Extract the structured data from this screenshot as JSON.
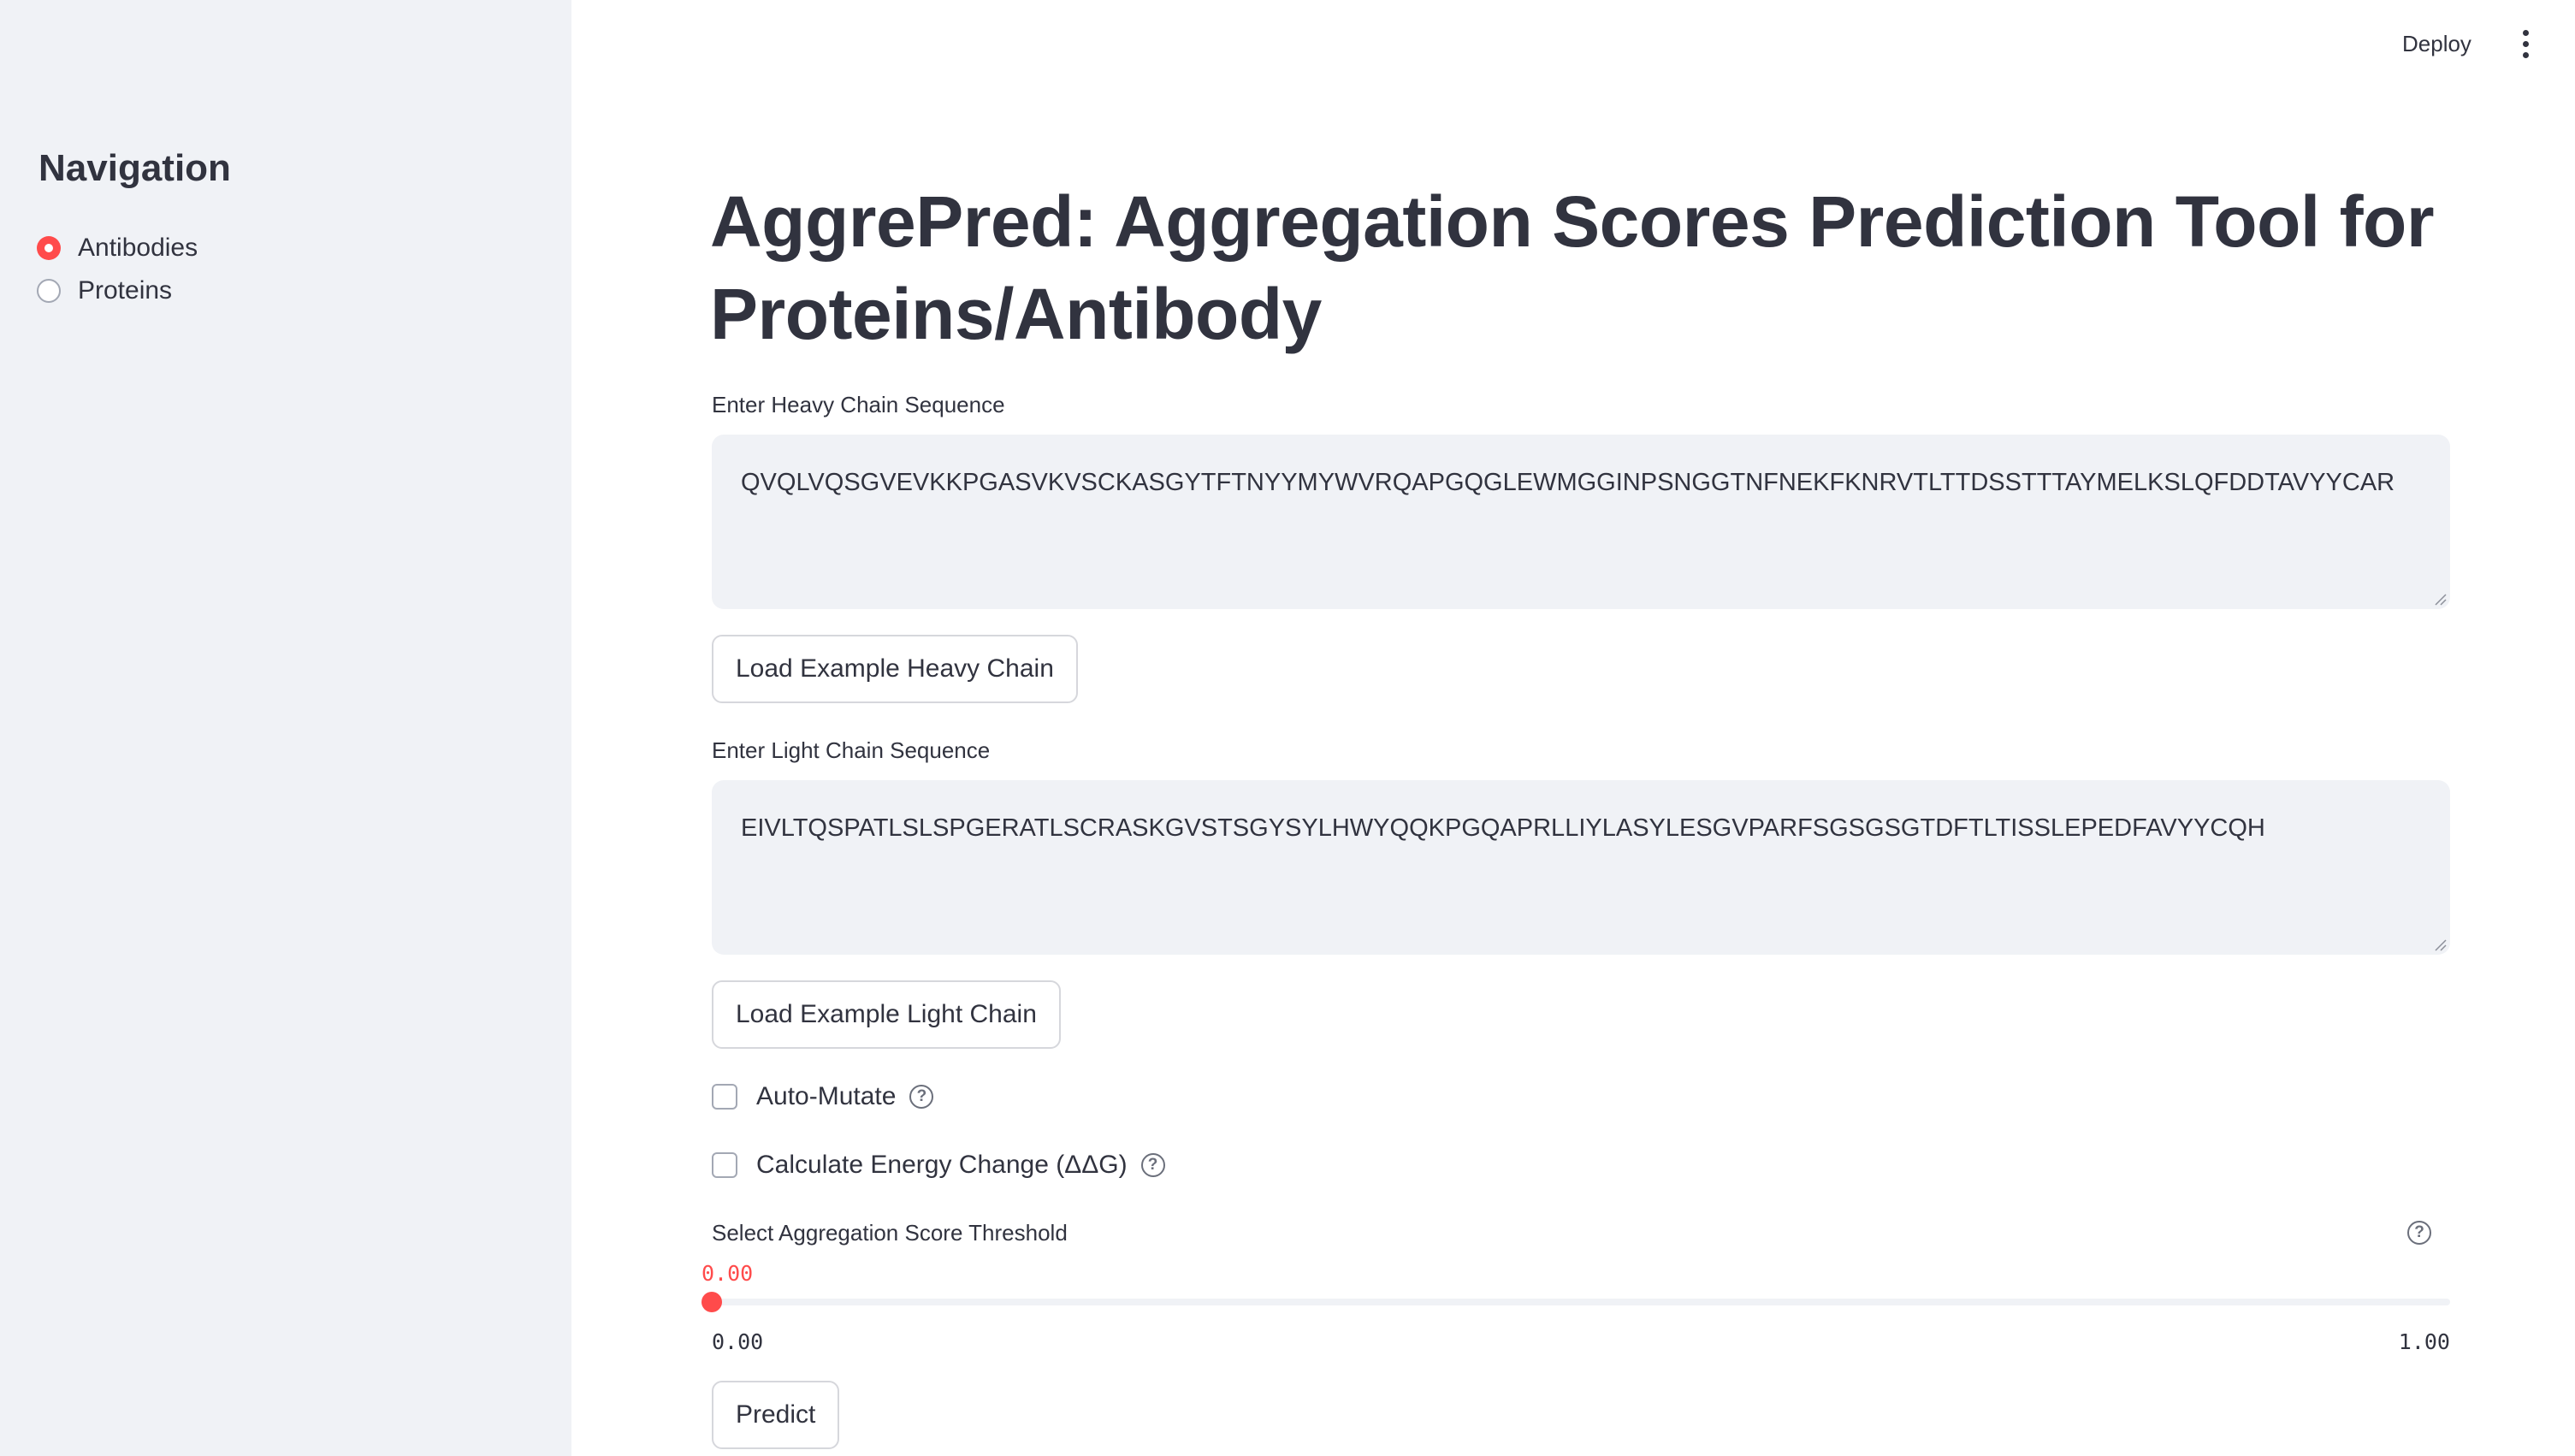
{
  "header": {
    "deploy_label": "Deploy",
    "menu_icon": "kebab-menu-icon"
  },
  "sidebar": {
    "title": "Navigation",
    "options": [
      {
        "label": "Antibodies",
        "selected": true
      },
      {
        "label": "Proteins",
        "selected": false
      }
    ]
  },
  "main": {
    "title": "AggrePred: Aggregation Scores Prediction Tool for Proteins/Antibody",
    "heavy_chain": {
      "label": "Enter Heavy Chain Sequence",
      "value": "QVQLVQSGVEVKKPGASVKVSCKASGYTFTNYYMYWVRQAPGQGLEWMGGINPSNGGTNFNEKFKNRVTLTTDSSTTTAYMELKSLQFDDTAVYYCAR",
      "button": "Load Example Heavy Chain"
    },
    "light_chain": {
      "label": "Enter Light Chain Sequence",
      "value": "EIVLTQSPATLSLSPGERATLSCRASKGVSTSGYSYLHWYQQKPGQAPRLLIYLASYLESGVPARFSGSGSGTDFTLTISSLEPEDFAVYYCQH",
      "button": "Load Example Light Chain"
    },
    "auto_mutate": {
      "label": "Auto-Mutate",
      "checked": false
    },
    "energy_change": {
      "label": "Calculate Energy Change (ΔΔG)",
      "checked": false
    },
    "threshold": {
      "label": "Select Aggregation Score Threshold",
      "value": "0.00",
      "min": "0.00",
      "max": "1.00"
    },
    "predict_button": "Predict"
  },
  "colors": {
    "accent": "#ff4b4b",
    "sidebar_bg": "#f0f2f6",
    "text": "#31333f"
  }
}
